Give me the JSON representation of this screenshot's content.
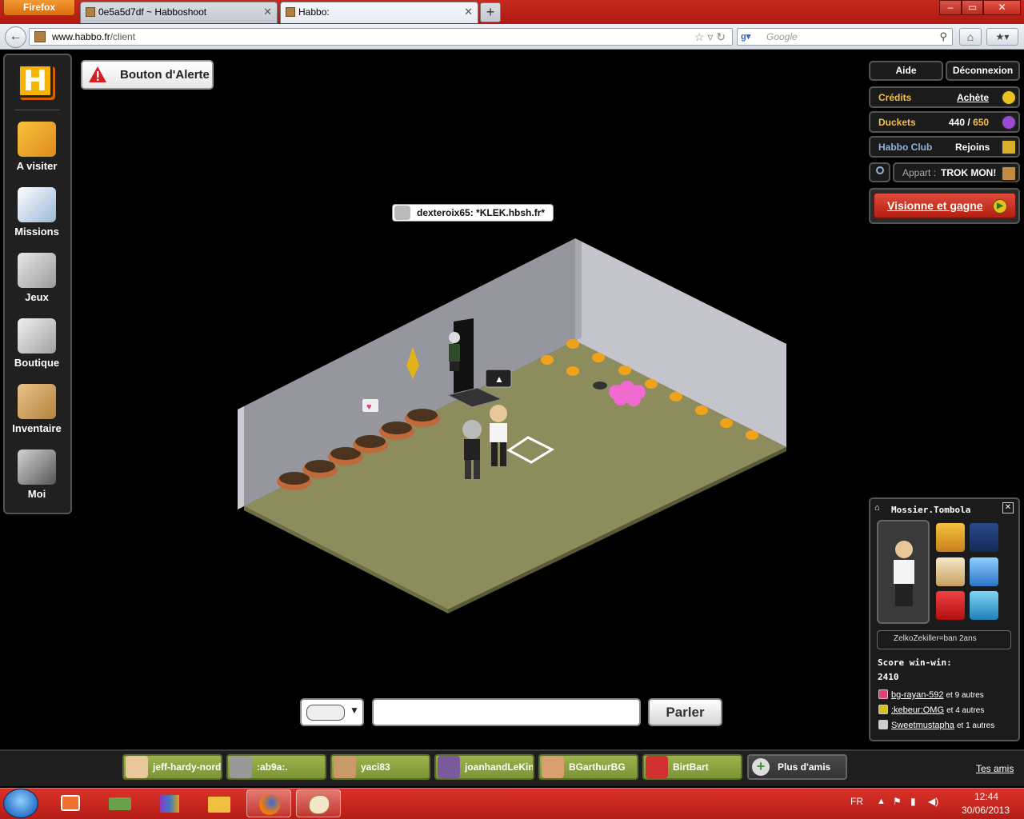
{
  "browser": {
    "app_button": "Firefox",
    "tabs": [
      {
        "label": "0e5a5d7df ~ Habboshoot"
      },
      {
        "label": "Habbo:"
      }
    ],
    "new_tab": "+",
    "url_domain": "www.habbo.fr",
    "url_path": "/client",
    "search_placeholder": "Google",
    "window_controls": {
      "minimize": "–",
      "restore": "▭",
      "close": "✕"
    }
  },
  "toolbar": {
    "items": [
      {
        "label": "A visiter",
        "icon": "navigator-icon"
      },
      {
        "label": "Missions",
        "icon": "missions-icon"
      },
      {
        "label": "Jeux",
        "icon": "games-icon"
      },
      {
        "label": "Boutique",
        "icon": "shop-icon"
      },
      {
        "label": "Inventaire",
        "icon": "inventory-icon"
      },
      {
        "label": "Moi",
        "icon": "me-avatar-icon"
      }
    ]
  },
  "alert_button": {
    "label": "Bouton d'Alerte"
  },
  "top_right": {
    "help": "Aide",
    "logout": "Déconnexion",
    "credits_label": "Crédits",
    "credits_action": "Achète",
    "duckets_label": "Duckets",
    "duckets_value": "440",
    "duckets_sep": "/",
    "duckets_max": "650",
    "club_label": "Habbo Club",
    "club_action": "Rejoins",
    "room_label": "Appart :",
    "room_name": "TROK MON!",
    "promo": "Visionne et gagne"
  },
  "room": {
    "chat_bubble": "dexteroix65: *KLEK.hbsh.fr*"
  },
  "profile": {
    "name": "Mossier.Tombola",
    "motto": "ZelkoZekiller=ban 2ans",
    "score_label": "Score win-win:",
    "score_value": "2410",
    "relations": [
      {
        "user": "bg-rayan-592",
        "rest": "et 9 autres",
        "color": "#e0407a"
      },
      {
        "user": ":kebeur:OMG",
        "rest": "et 4 autres",
        "color": "#d8c020"
      },
      {
        "user": "Sweetmustapha",
        "rest": "et 1 autres",
        "color": "#cccccc"
      }
    ],
    "badges": [
      "crown-badge",
      "sword-badge",
      "cup-badge",
      "pin-badge",
      "maman-heart-badge",
      "football-badge"
    ]
  },
  "chat": {
    "send": "Parler"
  },
  "friends": {
    "list": [
      {
        "name": "jeff-hardy-nord"
      },
      {
        "name": ":ab9a:."
      },
      {
        "name": "yaci83"
      },
      {
        "name": "joanhandLeKing"
      },
      {
        "name": "BGarthurBG"
      },
      {
        "name": "BirtBart"
      }
    ],
    "more": "Plus d'amis",
    "yours": "Tes amis"
  },
  "taskbar": {
    "lang": "FR",
    "time": "12:44",
    "date": "30/06/2013"
  }
}
